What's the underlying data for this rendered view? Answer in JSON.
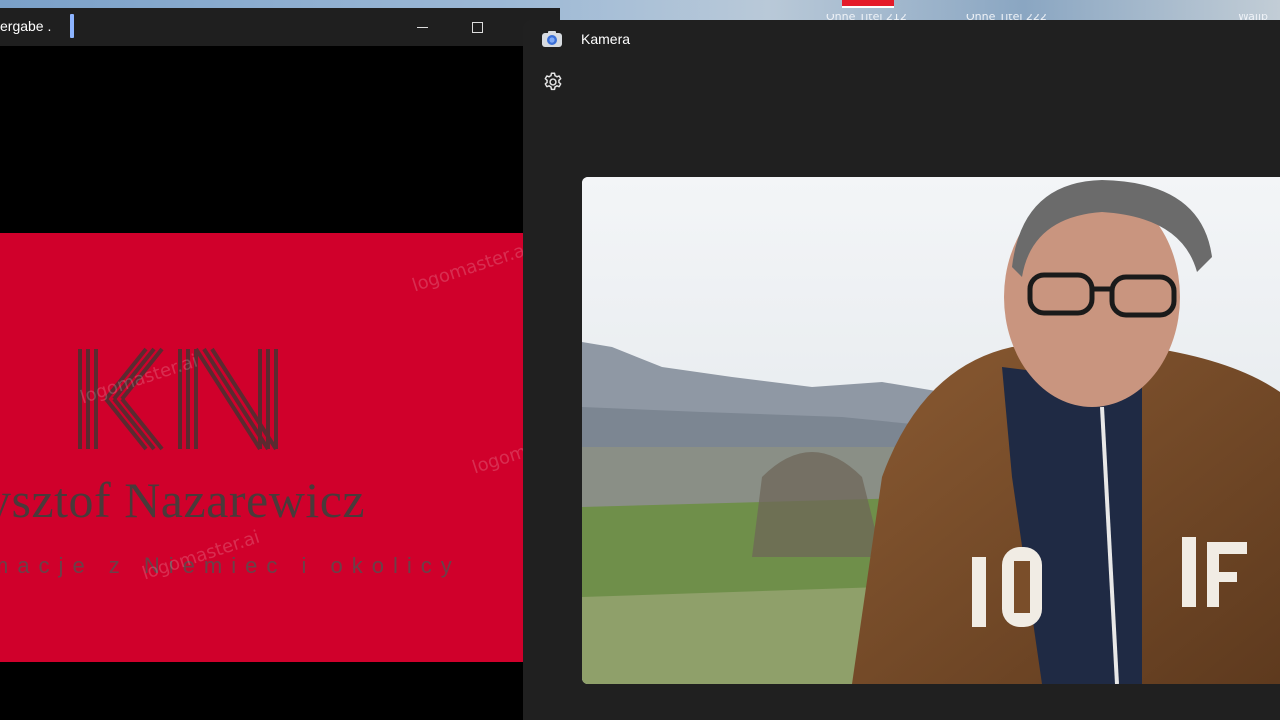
{
  "desktop": {
    "icon_labels": [
      "Ohne Titel 212",
      "Ohne Titel 222",
      "Wallp"
    ]
  },
  "player_window": {
    "title": "ergabe .",
    "slide": {
      "logo_text": "KN",
      "name": "ysztof Nazarewicz",
      "subtitle": "macje z Niemiec i okolicy",
      "watermark": "logomaster.ai"
    }
  },
  "camera_window": {
    "title": "Kamera",
    "settings_icon": "gear-icon",
    "app_icon": "camera-icon"
  },
  "colors": {
    "slide_red": "#d0002b",
    "dark_bg": "#202020",
    "titlebar": "#1f1f1f"
  }
}
